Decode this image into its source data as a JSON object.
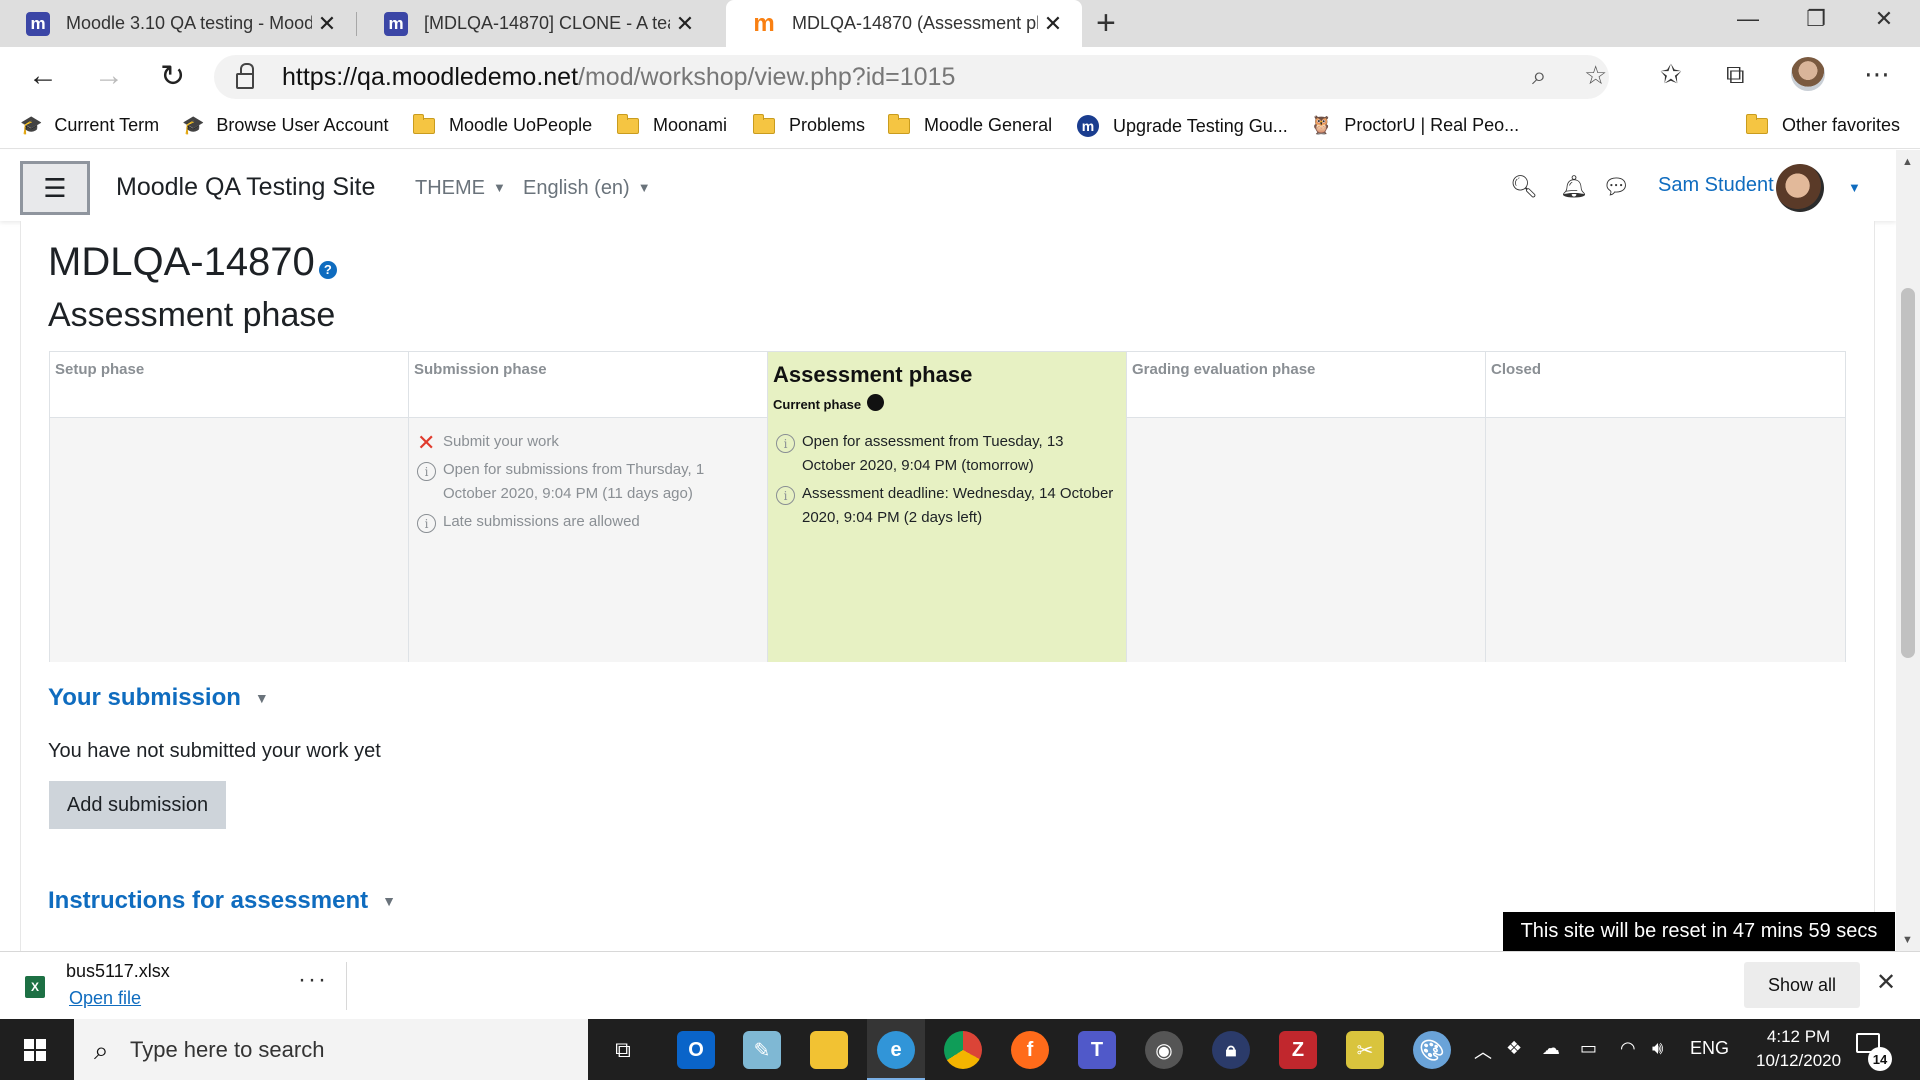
{
  "browser": {
    "tabs": [
      {
        "title": "Moodle 3.10 QA testing - Moodle",
        "fav": "m"
      },
      {
        "title": "[MDLQA-14870] CLONE - A teacher",
        "fav": "m"
      },
      {
        "title": "MDLQA-14870 (Assessment phase)",
        "fav": "m-orange"
      }
    ],
    "url_host": "https://qa.moodledemo.net",
    "url_path": "/mod/workshop/view.php?id=1015",
    "favorites": [
      {
        "label": "Current Term",
        "icon": "uopeople-icon"
      },
      {
        "label": "Browse User Account",
        "icon": "uopeople-icon"
      },
      {
        "label": "Moodle UoPeople",
        "icon": "folder-icon"
      },
      {
        "label": "Moonami",
        "icon": "folder-icon"
      },
      {
        "label": "Problems",
        "icon": "folder-icon"
      },
      {
        "label": "Moodle General",
        "icon": "folder-icon"
      },
      {
        "label": "Upgrade Testing Gu...",
        "icon": "moodle-circle-icon"
      },
      {
        "label": "ProctorU | Real Peo...",
        "icon": "owl-icon"
      }
    ],
    "other_favorites": "Other favorites"
  },
  "moodle_nav": {
    "site_name": "Moodle QA Testing Site",
    "theme_menu": "THEME",
    "language_menu": "English (en)",
    "user_name": "Sam Student"
  },
  "page": {
    "title": "MDLQA-14870",
    "help_glyph": "?",
    "phase_title": "Assessment phase",
    "phases": [
      {
        "name": "Setup phase",
        "tasks": []
      },
      {
        "name": "Submission phase",
        "tasks": [
          {
            "icon": "fail",
            "text": "Submit your work"
          },
          {
            "icon": "info",
            "text": "Open for submissions from Thursday, 1 October 2020, 9:04 PM (11 days ago)"
          },
          {
            "icon": "info",
            "text": "Late submissions are allowed"
          }
        ]
      },
      {
        "name": "Assessment phase",
        "current_label": "Current phase",
        "tasks": [
          {
            "icon": "info",
            "text": "Open for assessment from Tuesday, 13 October 2020, 9:04 PM (tomorrow)"
          },
          {
            "icon": "info",
            "text": "Assessment deadline: Wednesday, 14 October 2020, 9:04 PM (2 days left)"
          }
        ]
      },
      {
        "name": "Grading evaluation phase",
        "tasks": []
      },
      {
        "name": "Closed",
        "tasks": []
      }
    ],
    "your_submission": {
      "heading": "Your submission",
      "status": "You have not submitted your work yet",
      "button": "Add submission"
    },
    "instructions_heading": "Instructions for assessment",
    "reset_notice": "This site will be reset in 47 mins 59 secs"
  },
  "download_bar": {
    "filename": "bus5117.xlsx",
    "open_link": "Open file",
    "more": "···",
    "show_all": "Show all"
  },
  "taskbar": {
    "search_placeholder": "Type here to search",
    "lang": "ENG",
    "time": "4:12 PM",
    "date": "10/12/2020",
    "notifications": "14"
  },
  "colors": {
    "moodle_blue": "#0f6cbf",
    "active_phase": "#e7f1c3",
    "fail_red": "#e03b2d"
  }
}
